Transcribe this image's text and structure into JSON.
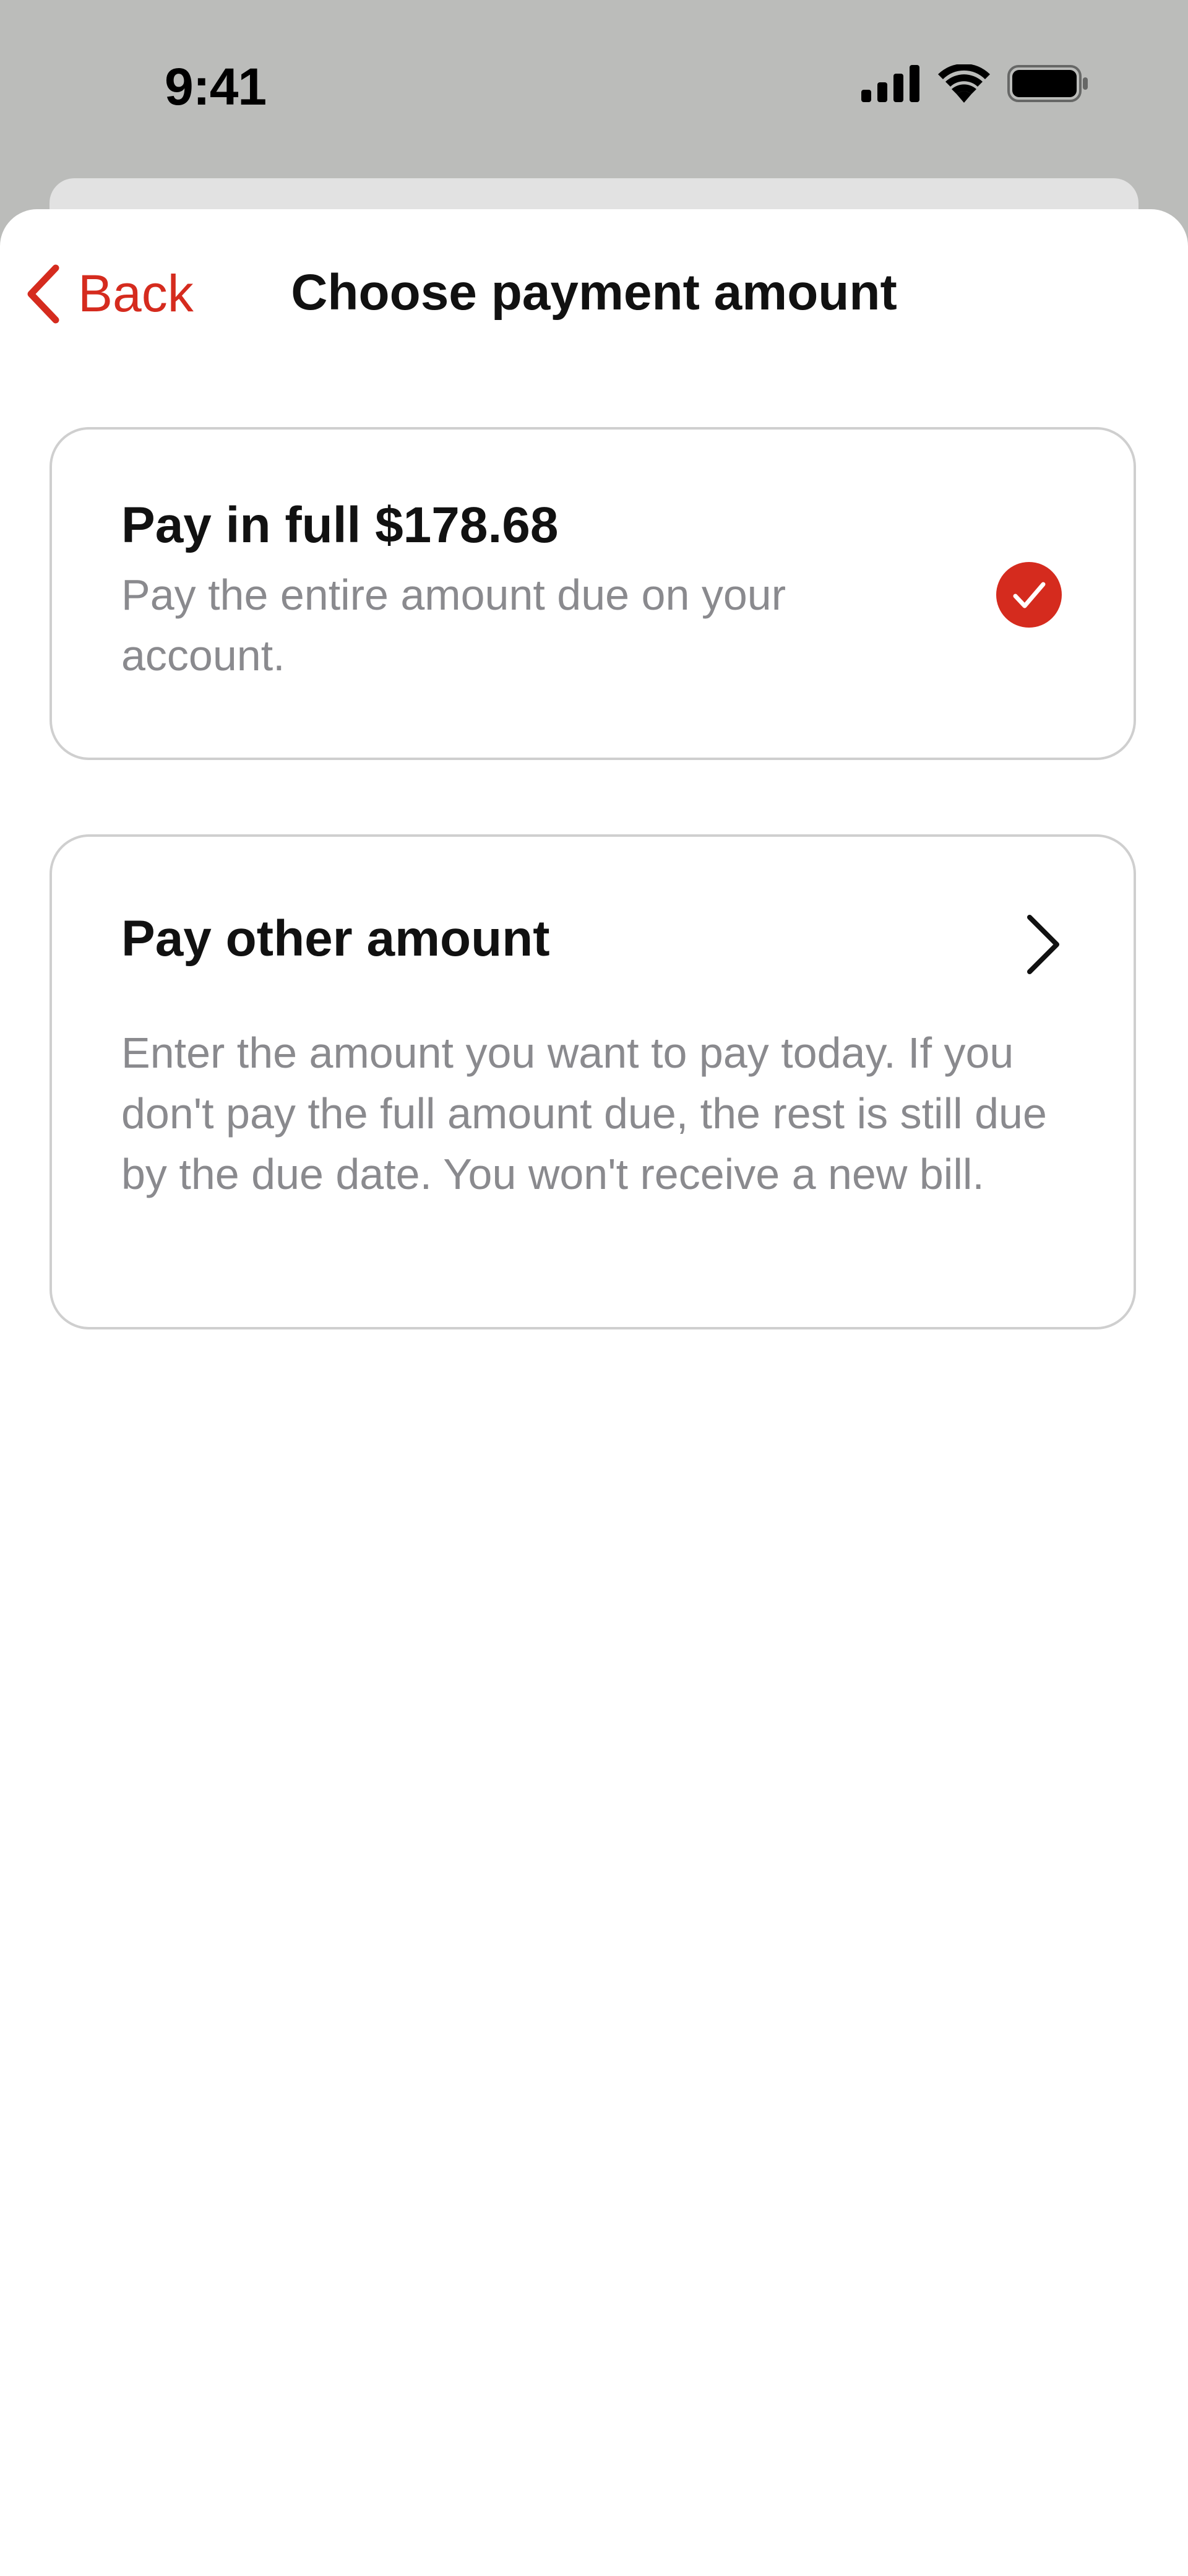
{
  "status_bar": {
    "time": "9:41",
    "icons": [
      "cellular-signal-icon",
      "wifi-icon",
      "battery-icon"
    ]
  },
  "nav": {
    "back_label": "Back",
    "title": "Choose payment amount"
  },
  "options": {
    "pay_full": {
      "title": "Pay in full $178.68",
      "description": "Pay the entire amount due on your account.",
      "selected": true
    },
    "pay_other": {
      "title": "Pay other amount",
      "description": "Enter the amount you want to pay today. If you don't pay the full amount due, the rest is still due by the due date. You won't receive a new bill."
    }
  },
  "colors": {
    "accent": "#d52b1e",
    "text_primary": "#111111",
    "text_secondary": "#8a8a8e",
    "card_border": "#cfcfcf",
    "background_dim": "#bbbcba"
  }
}
